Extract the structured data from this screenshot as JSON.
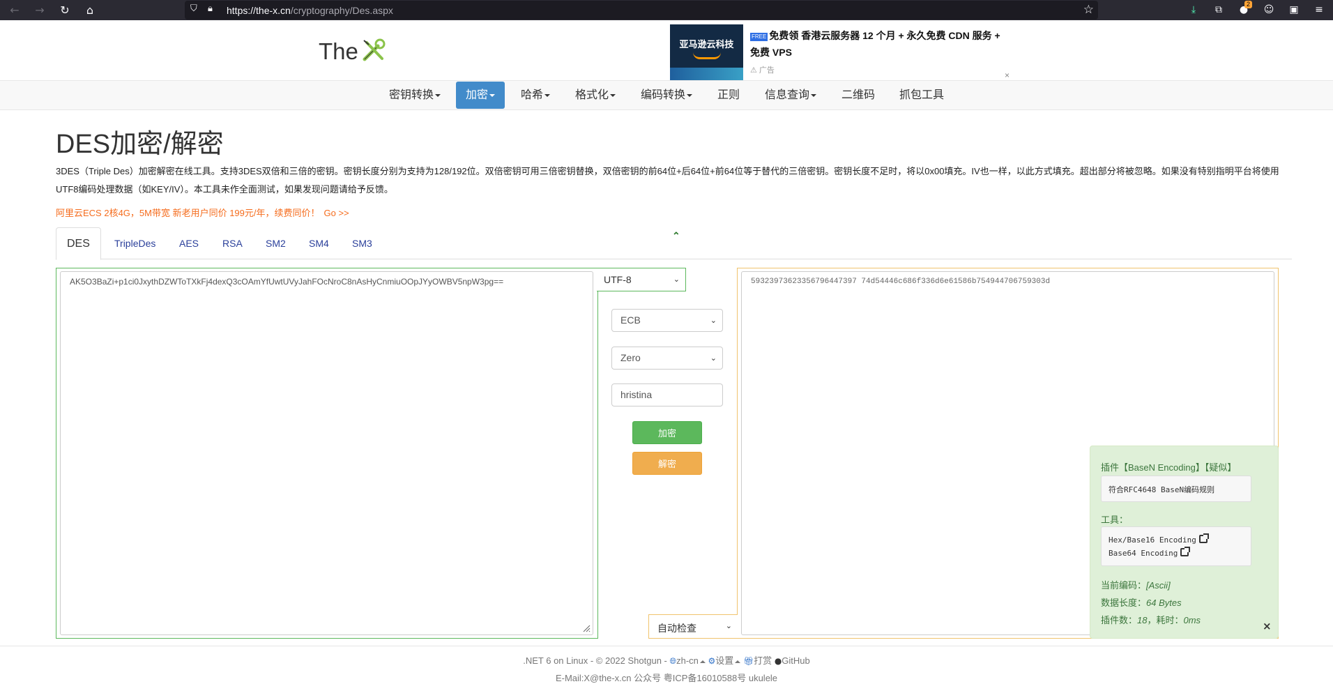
{
  "browser": {
    "url_host": "https://the-x.cn",
    "url_path": "/cryptography/Des.aspx",
    "extension_badge": "2"
  },
  "header": {
    "logo_text": "The",
    "ad": {
      "image_text": "亚马逊云科技",
      "free_tag": "FREE",
      "line1": "免费领 香港云服务器 12 个月 + 永久免费 CDN 服务 +",
      "line2": "免费 VPS",
      "label": "广告",
      "close": "×"
    }
  },
  "navbar": {
    "items": [
      {
        "label": "密钥转换",
        "dropdown": true
      },
      {
        "label": "加密",
        "dropdown": true,
        "active": true
      },
      {
        "label": "哈希",
        "dropdown": true
      },
      {
        "label": "格式化",
        "dropdown": true
      },
      {
        "label": "编码转换",
        "dropdown": true
      },
      {
        "label": "正则",
        "dropdown": false
      },
      {
        "label": "信息查询",
        "dropdown": true
      },
      {
        "label": "二维码",
        "dropdown": false
      },
      {
        "label": "抓包工具",
        "dropdown": false
      }
    ]
  },
  "main": {
    "title": "DES加密/解密",
    "description": "3DES（Triple Des）加密解密在线工具。支持3DES双倍和三倍的密钥。密钥长度分别为支持为128/192位。双倍密钥可用三倍密钥替换，双倍密钥的前64位+后64位+前64位等于替代的三倍密钥。密钥长度不足时，将以0x00填充。IV也一样，以此方式填充。超出部分将被忽略。如果没有特别指明平台将使用UTF8编码处理数据（如KEY/IV）。本工具未作全面测试，如果发现问题请给予反馈。",
    "promo": "阿里云ECS 2核4G，5M带宽 新老用户同价 199元/年，续费同价！",
    "promo_link": "Go >>",
    "tabs": [
      "DES",
      "TripleDes",
      "AES",
      "RSA",
      "SM2",
      "SM4",
      "SM3"
    ],
    "active_tab": "DES"
  },
  "form": {
    "input_value": "AK5O3BaZi+p1ci0JxythDZWToTXkFj4dexQ3cOAmYfUwtUVyJahFOcNroC8nAsHyCnmiuOOpJYyOWBV5npW3pg==",
    "encoding": "UTF-8",
    "mode": "ECB",
    "padding": "Zero",
    "key": "hristina",
    "encrypt_label": "加密",
    "decrypt_label": "解密",
    "output_value": "59323973623356796447397 74d54446c686f336d6e61586b754944706759303d",
    "output_encoding": "自动检查"
  },
  "plugin": {
    "title": "插件【BaseN Encoding】【疑似】",
    "rule": "符合RFC4648 BaseN编码规则",
    "tools_label": "工具：",
    "tools": [
      "Hex/Base16 Encoding",
      "Base64 Encoding"
    ],
    "current_encoding_label": "当前编码：",
    "current_encoding": "[Ascii]",
    "data_length_label": "数据长度：",
    "data_length": "64 Bytes",
    "plugin_count_label": "插件数：",
    "plugin_count": "18",
    "time_label": "，耗时：",
    "time": "0ms",
    "close": "×"
  },
  "footer": {
    "line1_prefix": ".NET 6 on Linux - © 2022 Shotgun -",
    "lang": "zh-cn",
    "settings": "设置",
    "donate": "打赏",
    "github": "GitHub",
    "line2": "E-Mail:X@the-x.cn 公众号 粤ICP备16010588号 ukulele"
  }
}
